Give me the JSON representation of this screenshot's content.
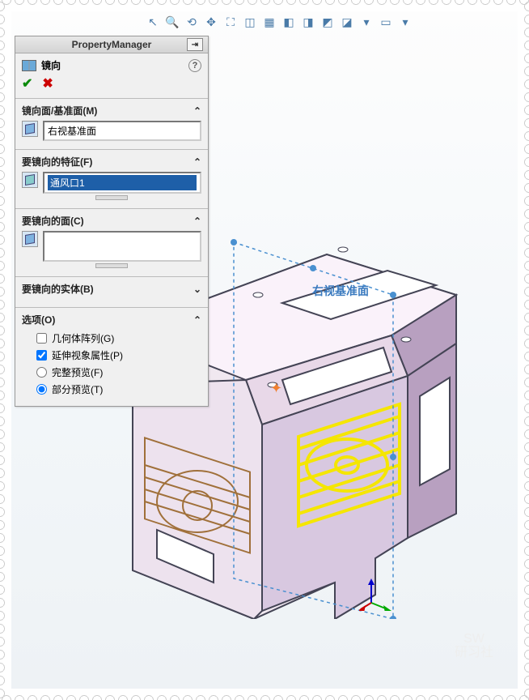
{
  "toolbar_icons": [
    "arrow",
    "zoom",
    "rotate",
    "pan",
    "fit",
    "section",
    "view1",
    "view2",
    "view3",
    "view4",
    "view5",
    "menu",
    "display1",
    "display2"
  ],
  "panel": {
    "title": "PropertyManager",
    "command": "镜向",
    "sections": {
      "mirror_plane": {
        "label": "镜向面/基准面(M)",
        "value": "右视基准面"
      },
      "features": {
        "label": "要镜向的特征(F)",
        "value": "通风口1"
      },
      "faces": {
        "label": "要镜向的面(C)",
        "value": ""
      },
      "bodies": {
        "label": "要镜向的实体(B)"
      },
      "options": {
        "label": "选项(O)",
        "geom_pattern": "几何体阵列(G)",
        "propagate": "延伸视象属性(P)",
        "full_preview": "完整预览(F)",
        "partial_preview": "部分预览(T)"
      }
    }
  },
  "viewport": {
    "plane_label": "右视基准面",
    "watermark_top": "SW",
    "watermark_bottom": "研习社"
  }
}
